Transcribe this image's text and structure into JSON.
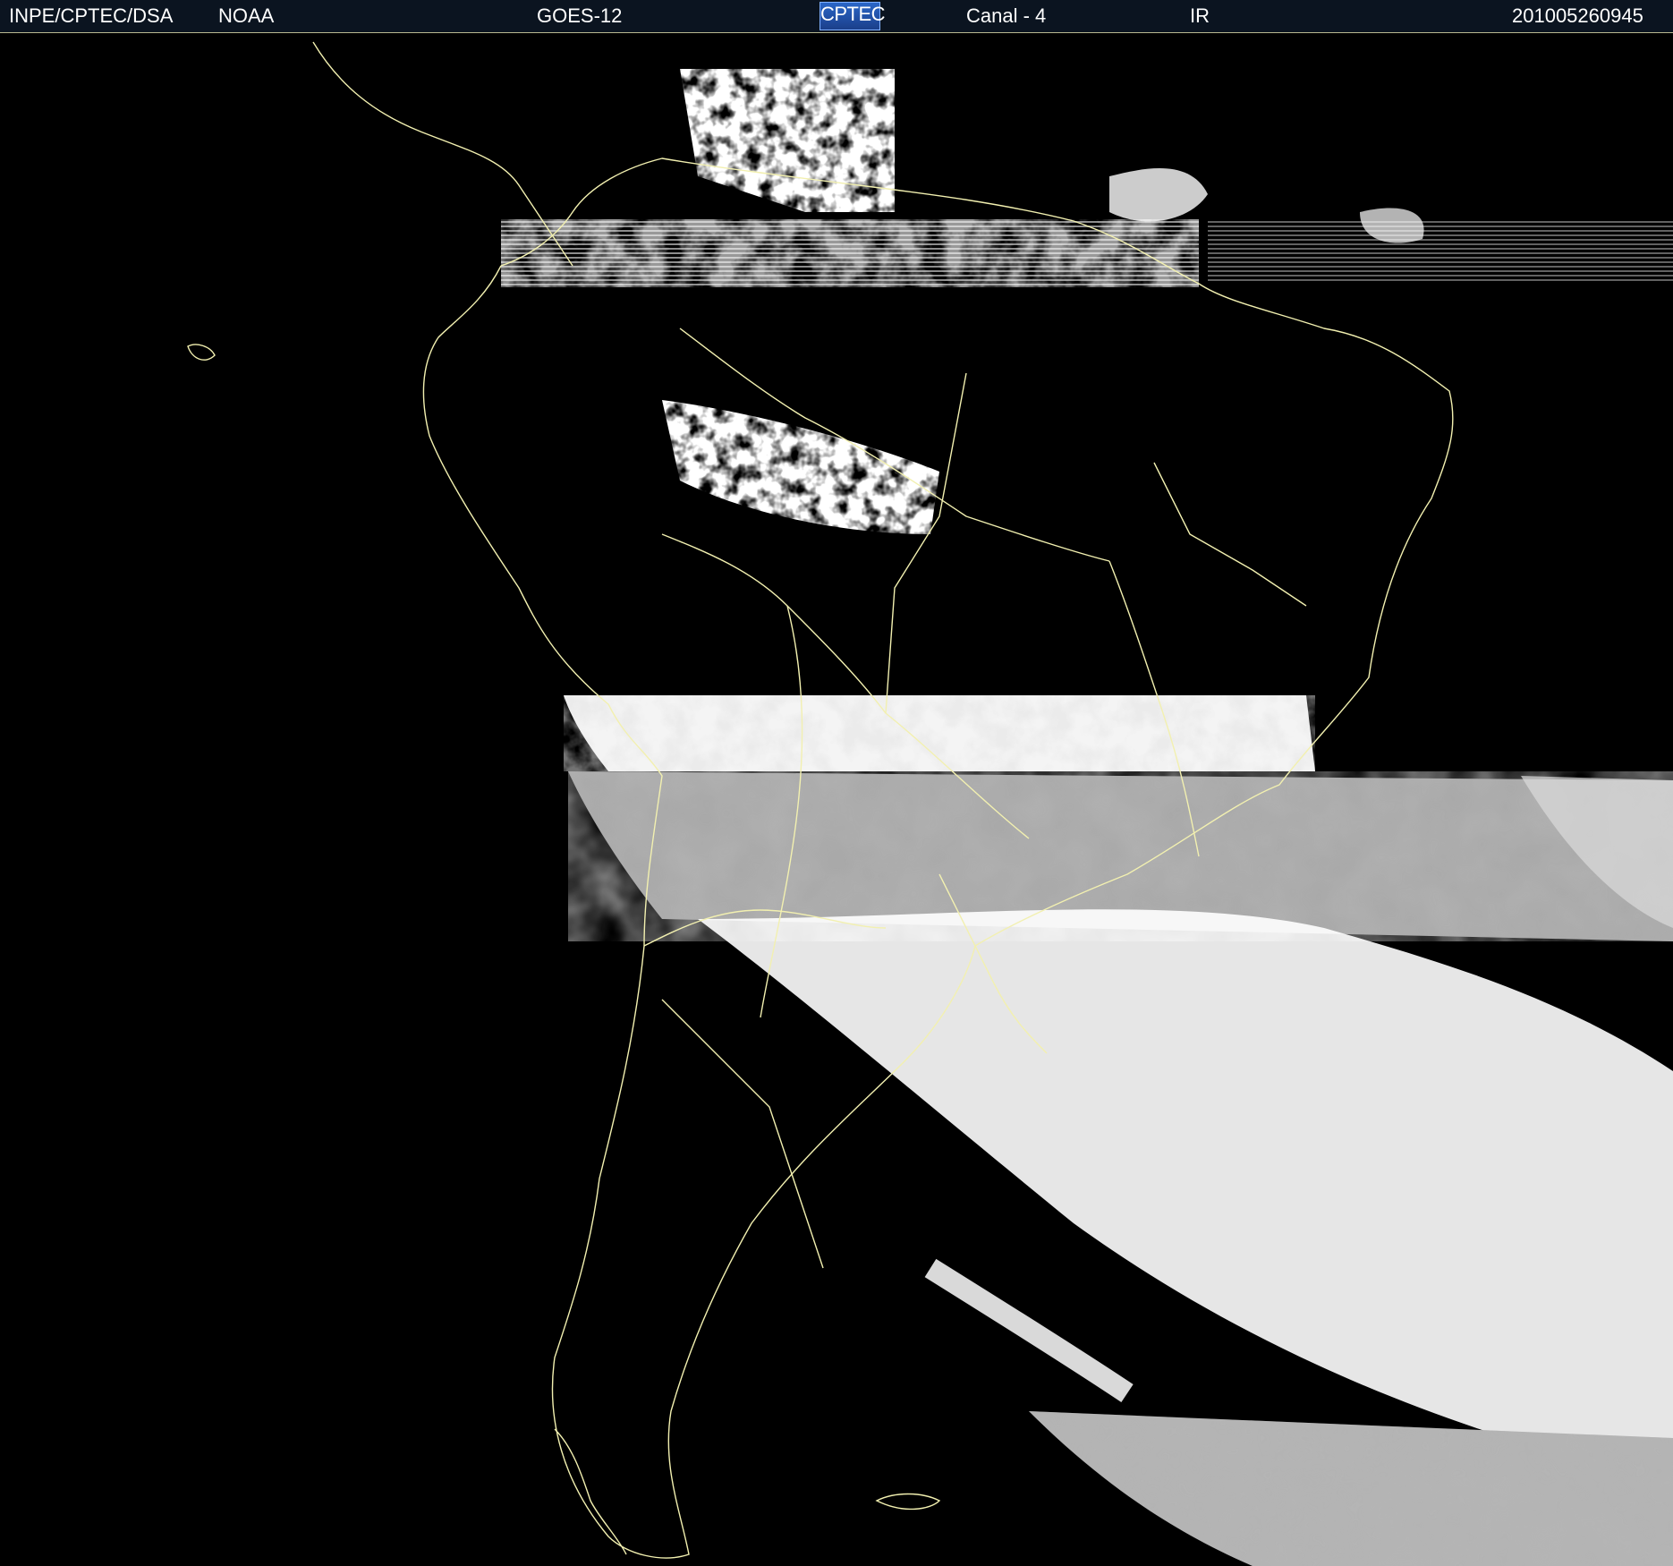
{
  "header": {
    "agency": "INPE/CPTEC/DSA",
    "provider": "NOAA",
    "satellite": "GOES-12",
    "logo_text": "CPTEC",
    "channel": "Canal - 4",
    "band": "IR",
    "timestamp": "201005260945"
  },
  "colors": {
    "background": "#000000",
    "header_bg": "#0b1420",
    "borders": "#f2f0b0",
    "cloud_bright": "#ffffff",
    "cloud_band_gray": "#a8a8a8"
  },
  "map": {
    "region": "South America",
    "image_type": "infrared satellite image"
  }
}
